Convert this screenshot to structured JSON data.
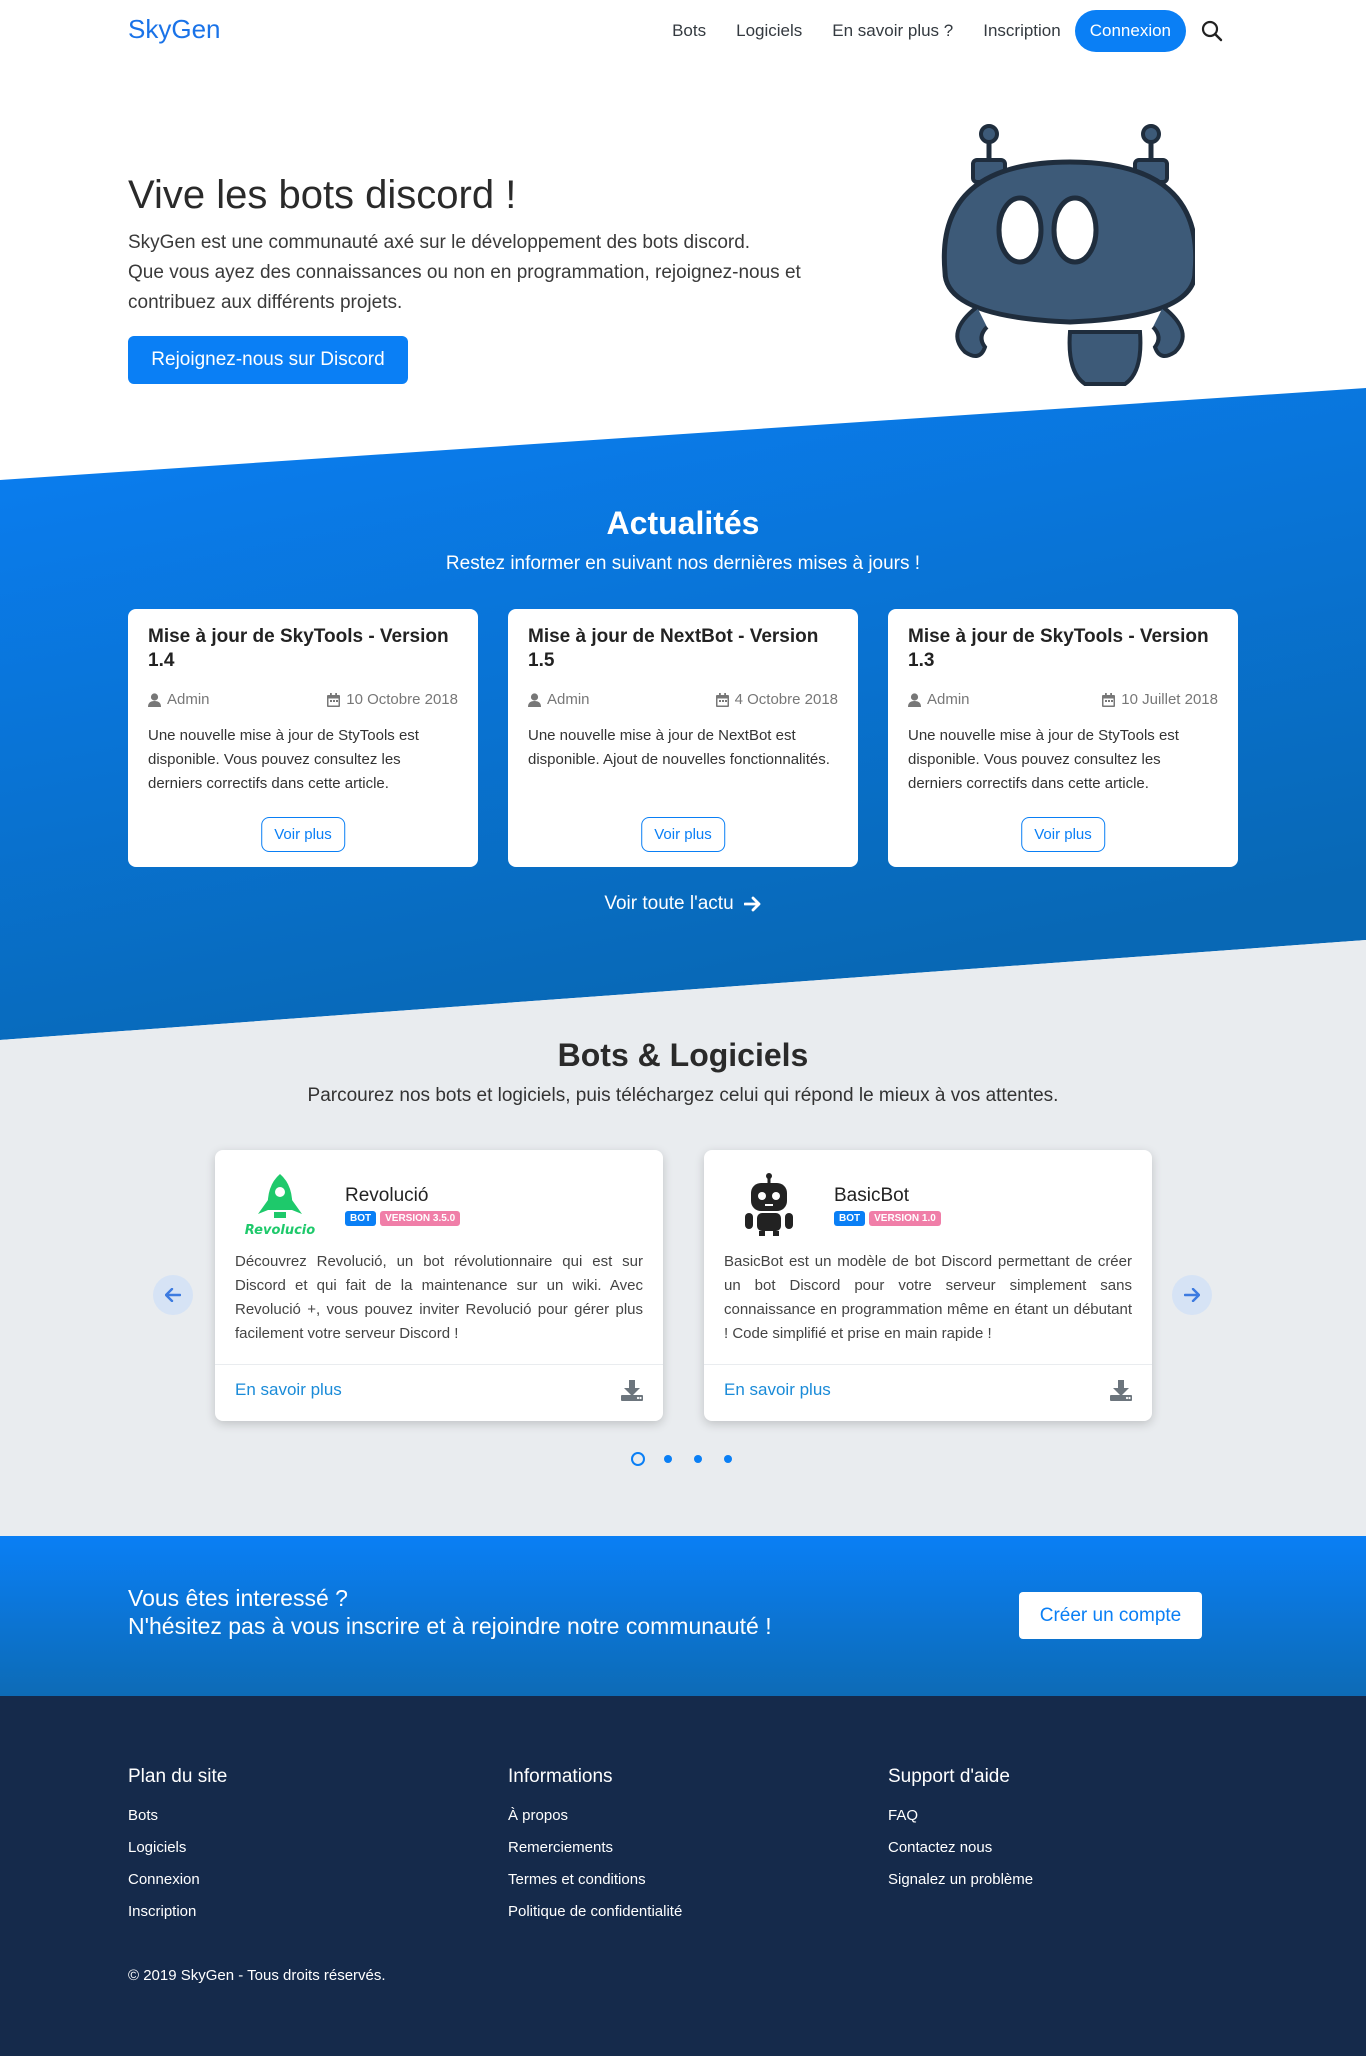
{
  "nav": {
    "brand": "SkyGen",
    "links": [
      "Bots",
      "Logiciels",
      "En savoir plus ?",
      "Inscription"
    ],
    "login": "Connexion"
  },
  "hero": {
    "title": "Vive les bots discord !",
    "lines": [
      "SkyGen est une communauté axé sur le développement des bots discord.",
      "Que vous ayez des connaissances ou non en programmation, rejoignez-nous et",
      "contribuez aux différents projets."
    ],
    "button": "Rejoignez-nous sur Discord"
  },
  "news": {
    "title": "Actualités",
    "subtitle": "Restez informer en suivant nos dernières mises à jours !",
    "cards": [
      {
        "title": "Mise à jour de SkyTools - Version 1.4",
        "author": "Admin",
        "date": "10 Octobre 2018",
        "text": "Une nouvelle mise à jour de StyTools est disponible. Vous pouvez consultez les derniers correctifs dans cette article.",
        "button": "Voir plus"
      },
      {
        "title": "Mise à jour de NextBot - Version 1.5",
        "author": "Admin",
        "date": "4 Octobre 2018",
        "text": "Une nouvelle mise à jour de NextBot est disponible. Ajout de nouvelles fonctionnalités.",
        "button": "Voir plus"
      },
      {
        "title": "Mise à jour de SkyTools - Version 1.3",
        "author": "Admin",
        "date": "10 Juillet 2018",
        "text": "Une nouvelle mise à jour de StyTools est disponible. Vous pouvez consultez les derniers correctifs dans cette article.",
        "button": "Voir plus"
      }
    ],
    "all_link": "Voir toute l'actu"
  },
  "bots": {
    "title": "Bots & Logiciels",
    "subtitle": "Parcourez nos bots et logiciels, puis téléchargez celui qui répond le mieux à vos attentes.",
    "items": [
      {
        "name": "Revolució",
        "logo_text": "Revolucio",
        "type": "BOT",
        "version": "VERSION 3.5.0",
        "description": "Découvrez Revolució, un bot révolutionnaire qui est sur Discord et qui fait de la maintenance sur un wiki. Avec Revolució +, vous pouvez inviter Revolució pour gérer plus facilement votre serveur Discord !",
        "more": "En savoir plus"
      },
      {
        "name": "BasicBot",
        "type": "BOT",
        "version": "VERSION 1.0",
        "description": "BasicBot est un modèle de bot Discord permettant de créer un bot Discord pour votre serveur simplement sans connaissance en programmation même en étant un débutant ! Code simplifié et prise en main rapide !",
        "more": "En savoir plus"
      }
    ],
    "carousel_pages": 4,
    "active_page": 1
  },
  "cta": {
    "line1": "Vous êtes interessé ?",
    "line2": "N'hésitez pas à vous inscrire et à rejoindre notre communauté !",
    "button": "Créer un compte"
  },
  "footer": {
    "columns": [
      {
        "title": "Plan du site",
        "links": [
          "Bots",
          "Logiciels",
          "Connexion",
          "Inscription"
        ]
      },
      {
        "title": "Informations",
        "links": [
          "À propos",
          "Remerciements",
          "Termes et conditions",
          "Politique de confidentialité"
        ]
      },
      {
        "title": "Support d'aide",
        "links": [
          "FAQ",
          "Contactez nous",
          "Signalez un problème"
        ]
      }
    ],
    "copyright": "© 2019 SkyGen - Tous droits réservés."
  },
  "colors": {
    "primary": "#0a7ff5",
    "footer_bg": "#152a4b",
    "section_grey": "#e9ecef",
    "badge_version": "#f07ea8",
    "revolucio_green": "#1ec96b"
  }
}
